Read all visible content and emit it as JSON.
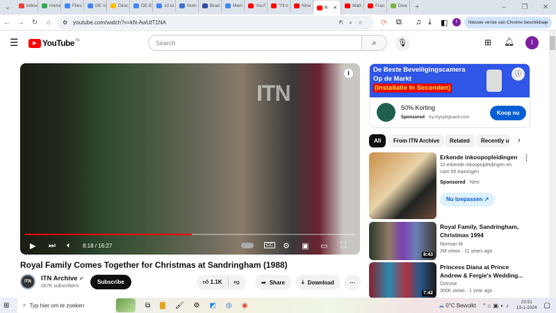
{
  "browser": {
    "tabs": [
      {
        "label": "Inbox",
        "color": "#ea4335"
      },
      {
        "label": "Home",
        "color": "#34a853"
      },
      {
        "label": "Files",
        "color": "#4285f4"
      },
      {
        "label": "DE ni",
        "color": "#4285f4"
      },
      {
        "label": "Direc",
        "color": "#fbbc04"
      },
      {
        "label": "DE-El",
        "color": "#4285f4"
      },
      {
        "label": "10 to",
        "color": "#4285f4"
      },
      {
        "label": "Num",
        "color": "#3b6fd6"
      },
      {
        "label": "Brad",
        "color": "#2d4e9e"
      },
      {
        "label": "Mem",
        "color": "#4285f4"
      },
      {
        "label": "YouT",
        "color": "#f00"
      },
      {
        "label": "\"I'll n",
        "color": "#f00"
      },
      {
        "label": "Nine",
        "color": "#f00"
      },
      {
        "label": "R",
        "color": "#f00",
        "active": true
      },
      {
        "label": "Matt",
        "color": "#f00"
      },
      {
        "label": "Fran",
        "color": "#f00"
      },
      {
        "label": "Dow",
        "color": "#7cb342"
      }
    ],
    "url": "youtube.com/watch?v=kN-AwUtT1NA",
    "update_label": "Nieuwe versie van Chrome beschikbaar",
    "profile_initial": "I"
  },
  "youtube": {
    "logo": "YouTube",
    "region": "NL",
    "search_placeholder": "Search",
    "avatar_initial": "I"
  },
  "video": {
    "watermark": "ITN",
    "time": "8:18 / 16:27",
    "progress": 0.505,
    "title": "Royal Family Comes Together for Christmas at Sandringham (1988)",
    "channel": "ITN Archive",
    "channel_logo": "ITN",
    "subscribers": "267K subscribers",
    "subscribe_label": "Subscribe",
    "likes": "1.1K",
    "share_label": "Share",
    "download_label": "Download"
  },
  "ad": {
    "banner_line1": "De Beste Beveiligingscamera",
    "banner_line2": "Op de Markt",
    "banner_line3": "(Installatie In Seconden)",
    "title": "50% Korting",
    "sponsored": "Sponsored",
    "domain": "try.myoptiguard.com",
    "cta": "Koop nu"
  },
  "chips": [
    "All",
    "From ITN Archive",
    "Related",
    "Recently up"
  ],
  "sponsored_item": {
    "title": "Erkende inkoopopleidingen",
    "desc": "10 erkende inkoopopleidingen en ruim 55 trainingen",
    "sponsored": "Sponsored",
    "advertiser": "Nevi",
    "cta": "Nu toepassen"
  },
  "related": [
    {
      "title": "Royal Family, Sandringham, Christmas 1994",
      "channel": "Norman M",
      "meta": "2M views · 11 years ago",
      "duration": "8:43"
    },
    {
      "title": "Princess Diana at Prince Andrew & Fergie's Wedding...",
      "channel": "Oztrose",
      "meta": "300K views · 1 year ago",
      "duration": "7:42"
    }
  ],
  "taskbar": {
    "search_placeholder": "Typ hier om te zoeken",
    "weather": "0°C  Bewolkt",
    "time": "23:51",
    "date": "13-1-2024"
  }
}
